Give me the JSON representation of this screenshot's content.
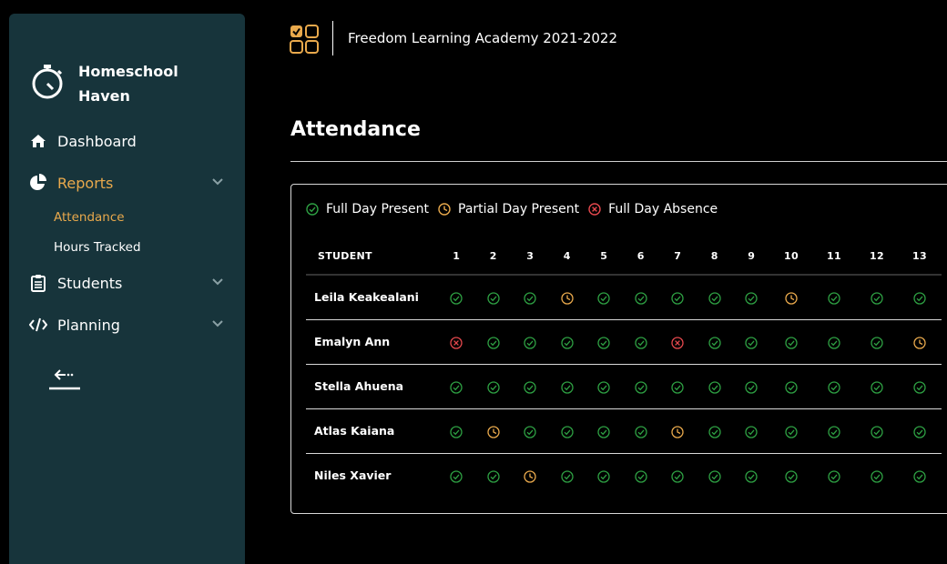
{
  "brand": {
    "line1": "Homeschool",
    "line2": "Haven"
  },
  "nav": {
    "dashboard": "Dashboard",
    "reports": "Reports",
    "attendance": "Attendance",
    "hours": "Hours Tracked",
    "students": "Students",
    "planning": "Planning"
  },
  "header": {
    "school": "Freedom Learning Academy 2021-2022"
  },
  "page": {
    "title": "Attendance"
  },
  "legend": {
    "present": "Full Day Present",
    "partial": "Partial Day Present",
    "absent": "Full Day Absence"
  },
  "table": {
    "student_header": "STUDENT",
    "days": [
      "1",
      "2",
      "3",
      "4",
      "5",
      "6",
      "7",
      "8",
      "9",
      "10",
      "11",
      "12",
      "13"
    ],
    "rows": [
      {
        "name": "Leila Keakealani",
        "status": [
          "P",
          "P",
          "P",
          "H",
          "P",
          "P",
          "P",
          "P",
          "P",
          "H",
          "P",
          "P",
          "P"
        ]
      },
      {
        "name": "Emalyn Ann",
        "status": [
          "A",
          "P",
          "P",
          "P",
          "P",
          "P",
          "A",
          "P",
          "P",
          "P",
          "P",
          "P",
          "H"
        ]
      },
      {
        "name": "Stella Ahuena",
        "status": [
          "P",
          "P",
          "P",
          "P",
          "P",
          "P",
          "P",
          "P",
          "P",
          "P",
          "P",
          "P",
          "P"
        ]
      },
      {
        "name": "Atlas Kaiana",
        "status": [
          "P",
          "H",
          "P",
          "P",
          "P",
          "P",
          "H",
          "P",
          "P",
          "P",
          "P",
          "P",
          "P"
        ]
      },
      {
        "name": "Niles Xavier",
        "status": [
          "P",
          "P",
          "H",
          "P",
          "P",
          "P",
          "P",
          "P",
          "P",
          "P",
          "P",
          "P",
          "P"
        ]
      }
    ]
  },
  "colors": {
    "present": "#2ea043",
    "partial": "#e9a94c",
    "absent": "#e5484d",
    "sidebar": "#17343b"
  }
}
